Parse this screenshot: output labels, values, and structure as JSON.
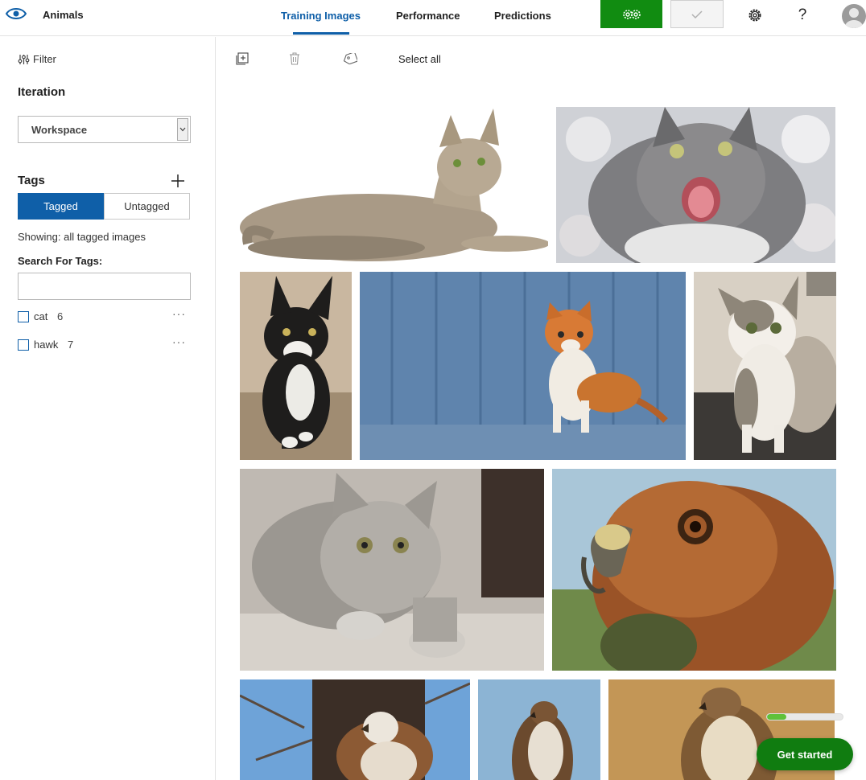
{
  "app": {
    "title": "Animals"
  },
  "nav": {
    "tabs": [
      {
        "label": "Training Images",
        "active": true
      },
      {
        "label": "Performance",
        "active": false
      },
      {
        "label": "Predictions",
        "active": false
      }
    ],
    "train_icon": "gears-icon",
    "quick_test_icon": "checkmark-icon",
    "settings_icon": "gear-icon",
    "help_label": "?",
    "profile_icon": "avatar"
  },
  "sidebar": {
    "filter_label": "Filter",
    "iteration_title": "Iteration",
    "iteration_selected": "Workspace",
    "tags_title": "Tags",
    "toggle": {
      "tagged": "Tagged",
      "untagged": "Untagged",
      "active": "tagged"
    },
    "showing_text": "Showing: all tagged images",
    "search_label": "Search For Tags:",
    "search_value": "",
    "tags": [
      {
        "name": "cat",
        "count": "6",
        "checked": false
      },
      {
        "name": "hawk",
        "count": "7",
        "checked": false
      }
    ]
  },
  "toolbar": {
    "add_icon": "add-images-icon",
    "delete_icon": "trash-icon",
    "tag_icon": "tag-icon",
    "select_all_label": "Select all"
  },
  "images": [
    {
      "name": "cat-lying-white-bg",
      "subject": "cat"
    },
    {
      "name": "cat-hissing",
      "subject": "cat"
    },
    {
      "name": "cat-black-white-walking",
      "subject": "cat"
    },
    {
      "name": "kitten-ginger-blue-wall",
      "subject": "cat"
    },
    {
      "name": "kitten-tabby-white",
      "subject": "cat"
    },
    {
      "name": "cat-gray-tabby-lying",
      "subject": "cat"
    },
    {
      "name": "hawk-head-closeup",
      "subject": "hawk"
    },
    {
      "name": "hawk-on-tree",
      "subject": "hawk"
    },
    {
      "name": "hawk-perched-sky",
      "subject": "hawk"
    },
    {
      "name": "hawk-tan-background",
      "subject": "hawk"
    }
  ],
  "onboarding": {
    "button_label": "Get started",
    "progress": 0.25
  },
  "colors": {
    "accent": "#0f5fa8",
    "train_green": "#118c11",
    "get_started_green": "#107c10"
  }
}
